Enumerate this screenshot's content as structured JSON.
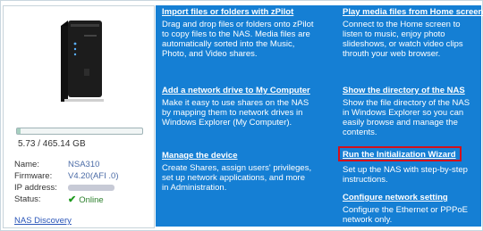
{
  "device": {
    "storage": "5.73 / 465.14 GB",
    "used_fraction": 0.0123,
    "info": [
      {
        "label": "Name:",
        "value": "NSA310"
      },
      {
        "label": "Firmware:",
        "value": "V4.20(AFI .0)"
      },
      {
        "label": "IP address:",
        "value": ""
      },
      {
        "label": "Status:",
        "value": "Online"
      }
    ],
    "discovery_link": "NAS Discovery"
  },
  "tasks": {
    "import": {
      "title": "Import files or folders with zPilot",
      "desc": "Drag and drop files or folders onto zPilot to copy files to the NAS. Media files are automatically sorted into the Music, Photo, and Video shares."
    },
    "play_media": {
      "title": "Play media files from Home screen",
      "desc": "Connect to the Home screen to listen to music, enjoy photo slideshows, or watch video clips throuth your web browser."
    },
    "network_drive": {
      "title": "Add a network drive to My Computer",
      "desc": "Make it easy to use shares on the NAS by mapping them to network drives in Windows Explorer (My Computer)."
    },
    "show_directory": {
      "title": "Show the directory of the NAS",
      "desc": "Show the file directory of the NAS in Windows Explorer so you can easily browse and manage the contents."
    },
    "manage_device": {
      "title": "Manage the device",
      "desc": "Create Shares, assign users' privileges, set up network applications, and more in Administration."
    },
    "init_wizard": {
      "title": "Run the Initialization Wizard",
      "desc": "Set up the NAS with step-by-step instructions."
    },
    "network_setting": {
      "title": "Configure network setting",
      "desc": "Configure the Ethernet or PPPoE network only."
    }
  },
  "colors": {
    "panel_blue": "#157fd4",
    "highlight_red": "#d3101b",
    "online_green": "#1e9a1e"
  }
}
